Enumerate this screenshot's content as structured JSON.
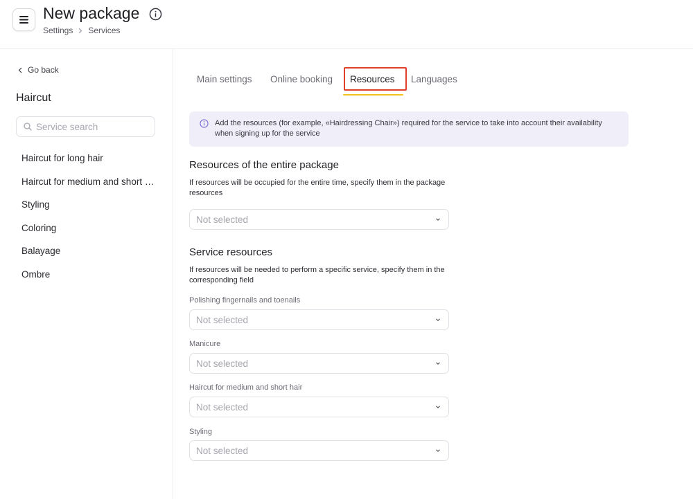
{
  "header": {
    "title": "New package",
    "breadcrumb": [
      "Settings",
      "Services"
    ]
  },
  "sidebar": {
    "go_back": "Go back",
    "title": "Haircut",
    "search_placeholder": "Service search",
    "items": [
      "Haircut for long hair",
      "Haircut for medium and short hair",
      "Styling",
      "Coloring",
      "Balayage",
      "Ombre"
    ]
  },
  "tabs": [
    {
      "label": "Main settings",
      "active": false
    },
    {
      "label": "Online booking",
      "active": false
    },
    {
      "label": "Resources",
      "active": true
    },
    {
      "label": "Languages",
      "active": false
    }
  ],
  "notice": "Add the resources (for example, «Hairdressing Chair») required for the service to take into account their availability when signing up for the service",
  "package_resources": {
    "title": "Resources of the entire package",
    "description": "If resources will be occupied for the entire time, specify them in the package resources",
    "value": "Not selected"
  },
  "service_resources": {
    "title": "Service resources",
    "description": "If resources will be needed to perform a specific service, specify them in the corresponding field",
    "fields": [
      {
        "label": "Polishing fingernails and toenails",
        "value": "Not selected"
      },
      {
        "label": "Manicure",
        "value": "Not selected"
      },
      {
        "label": "Haircut for medium and short hair",
        "value": "Not selected"
      },
      {
        "label": "Styling",
        "value": "Not selected"
      }
    ]
  },
  "colors": {
    "accent_underline": "#f2c21a",
    "highlight_frame": "#e0402a",
    "notice_bg": "#efeef9",
    "info_icon": "#7b6fd6"
  },
  "icons": [
    "menu-icon",
    "info-icon",
    "chevron-right-icon",
    "chevron-left-icon",
    "search-icon",
    "chevron-down-icon"
  ]
}
